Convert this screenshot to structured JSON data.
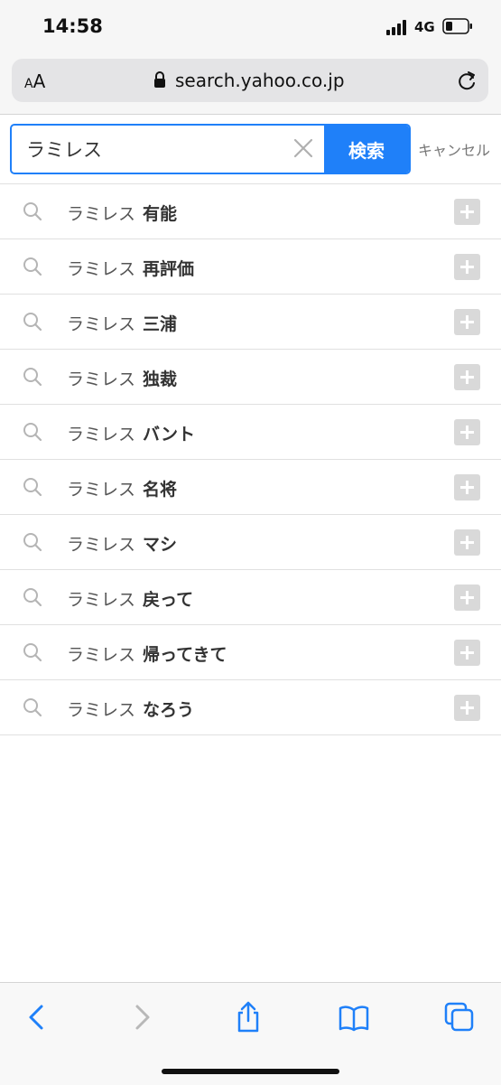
{
  "status_bar": {
    "time": "14:58",
    "network": "4G"
  },
  "browser": {
    "text_size_label_small": "A",
    "text_size_label_large": "A",
    "url": "search.yahoo.co.jp"
  },
  "search": {
    "query": "ラミレス",
    "submit_label": "検索",
    "cancel_label": "キャンセル"
  },
  "suggestions": [
    {
      "prefix": "ラミレス",
      "suffix": "有能"
    },
    {
      "prefix": "ラミレス",
      "suffix": "再評価"
    },
    {
      "prefix": "ラミレス",
      "suffix": "三浦"
    },
    {
      "prefix": "ラミレス",
      "suffix": "独裁"
    },
    {
      "prefix": "ラミレス",
      "suffix": "バント"
    },
    {
      "prefix": "ラミレス",
      "suffix": "名将"
    },
    {
      "prefix": "ラミレス",
      "suffix": "マシ"
    },
    {
      "prefix": "ラミレス",
      "suffix": "戻って"
    },
    {
      "prefix": "ラミレス",
      "suffix": "帰ってきて"
    },
    {
      "prefix": "ラミレス",
      "suffix": "なろう"
    }
  ],
  "colors": {
    "accent": "#1f80f9",
    "toolbar_icon": "#1f80f9",
    "disabled_icon": "#b8b8b8"
  },
  "icons": [
    "search-icon",
    "plus-icon",
    "lock-icon",
    "reload-icon",
    "clear-icon",
    "back-icon",
    "forward-icon",
    "share-icon",
    "bookmarks-icon",
    "tabs-icon"
  ]
}
